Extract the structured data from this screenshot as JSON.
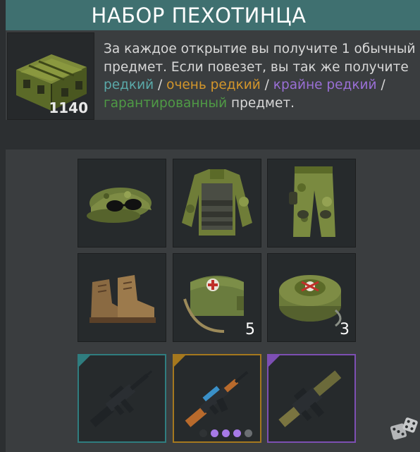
{
  "header": {
    "title": "НАБОР ПЕХОТИНЦА"
  },
  "crate": {
    "icon": "ammo-crate-icon",
    "count": "1140"
  },
  "description": {
    "line1": "За каждое открытие вы получите 1 обычный",
    "line2": "предмет. Если повезет, вы так же получите",
    "rare": "редкий",
    "sep1": " / ",
    "very_rare": "очень редкий",
    "sep2": " / ",
    "extremely_rare": "крайне редкий",
    "sep3": " /",
    "guaranteed": "гарантированный",
    "tail": " предмет."
  },
  "items": [
    {
      "name": "cap-with-sunglasses-icon",
      "count": ""
    },
    {
      "name": "camo-jacket-vest-icon",
      "count": ""
    },
    {
      "name": "camo-pants-icon",
      "count": ""
    },
    {
      "name": "boots-icon",
      "count": ""
    },
    {
      "name": "medkit-bag-icon",
      "count": "5"
    },
    {
      "name": "landmine-icon",
      "count": "3"
    },
    {
      "name": "m16-rifle-icon",
      "tier": "rare"
    },
    {
      "name": "ak-rifle-icon",
      "tier": "very-rare",
      "variants_total": 5,
      "variants_active": 3
    },
    {
      "name": "grenade-launcher-icon",
      "tier": "extremely-rare"
    }
  ],
  "colors": {
    "header_bg": "#3f7070",
    "rare": "#5aa9a9",
    "very_rare": "#d3962b",
    "extremely_rare": "#9a6fd6",
    "guaranteed": "#4f9a45",
    "dot_active": "#a77ae6",
    "dot_inactive": "#6b6f72"
  },
  "dice": {
    "icon": "dice-icon"
  }
}
